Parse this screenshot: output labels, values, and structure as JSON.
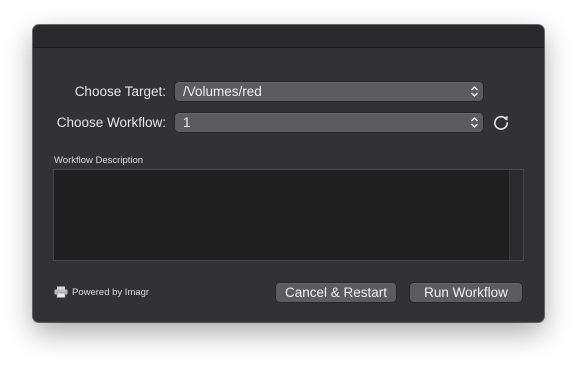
{
  "form": {
    "target_label": "Choose Target:",
    "target_value": "/Volumes/red",
    "workflow_label": "Choose Workflow:",
    "workflow_value": "1",
    "description_label": "Workflow Description",
    "description_text": ""
  },
  "footer": {
    "powered_by": "Powered by Imagr",
    "cancel_label": "Cancel & Restart",
    "run_label": "Run Workflow"
  },
  "icons": {
    "refresh": "refresh-icon",
    "imagr_logo": "printer-icon",
    "popup_arrows": "up-down-arrows-icon"
  }
}
